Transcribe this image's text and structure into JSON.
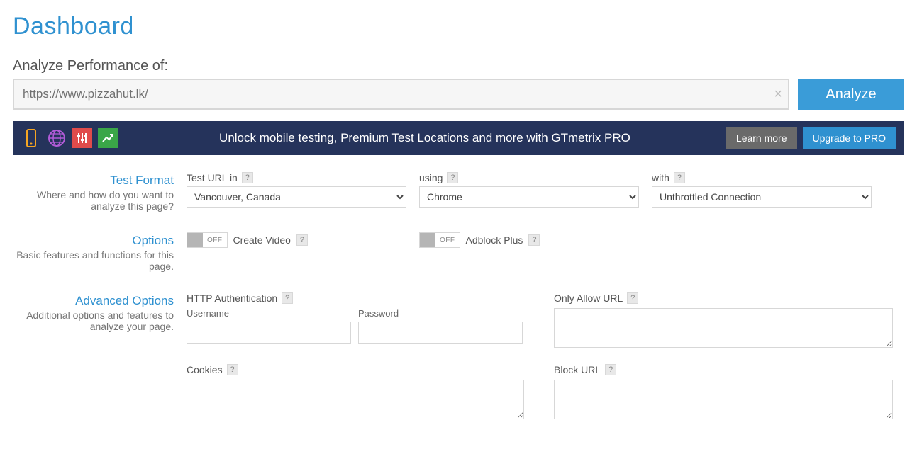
{
  "page_title": "Dashboard",
  "analyze": {
    "section_label": "Analyze Performance of:",
    "url_value": "https://www.pizzahut.lk/",
    "analyze_button": "Analyze"
  },
  "pro_banner": {
    "text": "Unlock mobile testing, Premium Test Locations and more with GTmetrix PRO",
    "learn_more": "Learn more",
    "upgrade": "Upgrade to PRO"
  },
  "test_format": {
    "title": "Test Format",
    "desc": "Where and how do you want to analyze this page?",
    "test_url_in_label": "Test URL in",
    "location_selected": "Vancouver, Canada",
    "using_label": "using",
    "browser_selected": "Chrome",
    "with_label": "with",
    "connection_selected": "Unthrottled Connection"
  },
  "options": {
    "title": "Options",
    "desc": "Basic features and functions for this page.",
    "off_text": "OFF",
    "create_video_label": "Create Video",
    "adblock_label": "Adblock Plus"
  },
  "advanced": {
    "title": "Advanced Options",
    "desc": "Additional options and features to analyze your page.",
    "http_auth_label": "HTTP Authentication",
    "username_label": "Username",
    "password_label": "Password",
    "only_allow_label": "Only Allow URL",
    "cookies_label": "Cookies",
    "block_url_label": "Block URL"
  }
}
